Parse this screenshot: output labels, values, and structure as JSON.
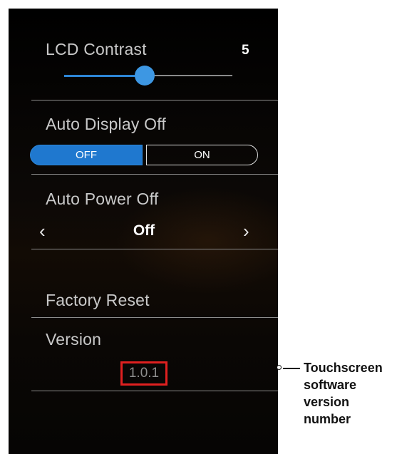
{
  "settings": {
    "lcd_contrast": {
      "label": "LCD Contrast",
      "value": "5",
      "slider_fraction": 0.48
    },
    "auto_display_off": {
      "label": "Auto Display Off",
      "options": [
        "OFF",
        "ON"
      ],
      "selected": "OFF"
    },
    "auto_power_off": {
      "label": "Auto Power Off",
      "value": "Off",
      "prev_icon": "chevron-left-icon",
      "next_icon": "chevron-right-icon"
    },
    "factory_reset": {
      "label": "Factory Reset"
    },
    "version": {
      "label": "Version",
      "value": "1.0.1"
    }
  },
  "callout": {
    "line1": "Touchscreen",
    "line2": "software",
    "line3": "version",
    "line4": "number"
  },
  "colors": {
    "accent": "#1f78cf",
    "highlight_box": "#e02020",
    "background": "#000000"
  }
}
